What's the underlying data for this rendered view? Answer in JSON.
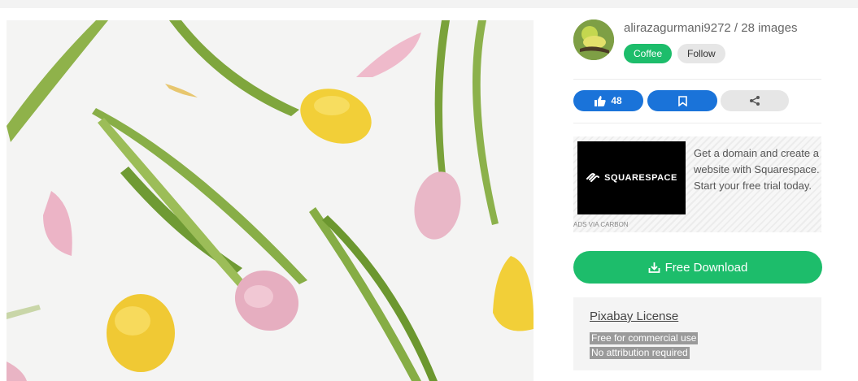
{
  "photo": {
    "description_icon": "tulips-photo"
  },
  "profile": {
    "username": "alirazagurmani9272 / 28 images",
    "coffee_label": "Coffee",
    "follow_label": "Follow",
    "avatar_icon": "bird-avatar"
  },
  "actions": {
    "like_count": "48",
    "like_icon": "thumbs-up-icon",
    "save_icon": "bookmark-icon",
    "share_icon": "share-icon"
  },
  "ad": {
    "brand": "SQUARESPACE",
    "text": "Get a domain and create a website with Squarespace. Start your free trial today.",
    "via": "ADS VIA CARBON"
  },
  "download": {
    "label": "Free Download",
    "icon": "download-icon"
  },
  "license": {
    "title": "Pixabay License",
    "lines": [
      "Free for commercial use",
      "No attribution required"
    ]
  },
  "colors": {
    "green": "#1dbd6b",
    "blue": "#1a73d9",
    "grey": "#e6e6e6"
  }
}
